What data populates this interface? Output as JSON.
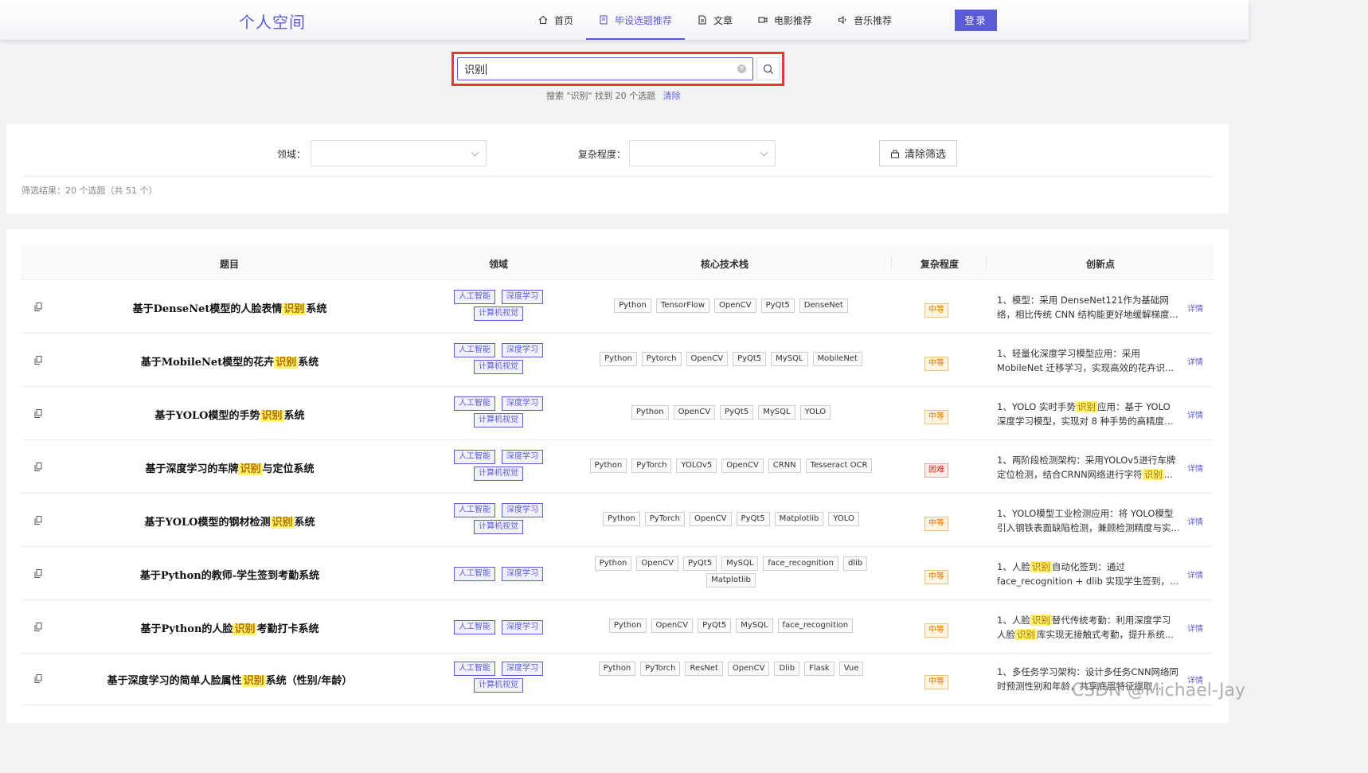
{
  "header": {
    "brand": "个人空间",
    "nav": [
      {
        "label": "首页",
        "icon": "home-icon"
      },
      {
        "label": "毕设选题推荐",
        "icon": "document-icon",
        "active": true
      },
      {
        "label": "文章",
        "icon": "article-icon"
      },
      {
        "label": "电影推荐",
        "icon": "video-icon"
      },
      {
        "label": "音乐推荐",
        "icon": "speaker-icon"
      }
    ],
    "login_label": "登录"
  },
  "search": {
    "value": "识别",
    "hint": "搜索 \"识别\" 找到 20 个选题",
    "clear_label": "清除"
  },
  "filter": {
    "domain_label": "领域：",
    "complexity_label": "复杂程度：",
    "clear_label": "清除筛选",
    "result_text": "筛选结果：20 个选题（共 51 个）"
  },
  "table": {
    "headers": [
      "题目",
      "领域",
      "核心技术栈",
      "复杂程度",
      "创新点"
    ],
    "detail_label": "详情",
    "rows": [
      {
        "title": [
          "基于DenseNet模型的人脸表情",
          "识别",
          "系统"
        ],
        "domains": [
          "人工智能",
          "深度学习",
          "计算机视觉"
        ],
        "tech": [
          "Python",
          "TensorFlow",
          "OpenCV",
          "PyQt5",
          "DenseNet"
        ],
        "complexity": "中等",
        "innovation": [
          "1、模型：采用 DenseNet121作为基础网",
          "络，相比传统 CNN 结构能更好地缓解梯度..."
        ]
      },
      {
        "title": [
          "基于MobileNet模型的花卉",
          "识别",
          "系统"
        ],
        "domains": [
          "人工智能",
          "深度学习",
          "计算机视觉"
        ],
        "tech": [
          "Python",
          "Pytorch",
          "OpenCV",
          "PyQt5",
          "MySQL",
          "MobileNet"
        ],
        "complexity": "中等",
        "innovation": [
          "1、轻量化深度学习模型应用：采用",
          "MobileNet 迁移学习，实现高效的花卉识..."
        ]
      },
      {
        "title": [
          "基于YOLO模型的手势",
          "识别",
          "系统"
        ],
        "domains": [
          "人工智能",
          "深度学习",
          "计算机视觉"
        ],
        "tech": [
          "Python",
          "OpenCV",
          "PyQt5",
          "MySQL",
          "YOLO"
        ],
        "complexity": "中等",
        "innovation": [
          "1、YOLO 实时手势识别应用：基于 YOLO",
          "深度学习模型，实现对 8 种手势的高精度实..."
        ]
      },
      {
        "title": [
          "基于深度学习的车牌",
          "识别",
          "与定位系统"
        ],
        "domains": [
          "人工智能",
          "深度学习",
          "计算机视觉"
        ],
        "tech": [
          "Python",
          "PyTorch",
          "YOLOv5",
          "OpenCV",
          "CRNN",
          "Tesseract OCR"
        ],
        "complexity": "困难",
        "innovation": [
          "1、两阶段检测架构：采用YOLOv5进行车牌",
          "定位检测，结合CRNN网络进行字符识别..."
        ]
      },
      {
        "title": [
          "基于YOLO模型的钢材检测",
          "识别",
          "系统"
        ],
        "domains": [
          "人工智能",
          "深度学习",
          "计算机视觉"
        ],
        "tech": [
          "Python",
          "PyTorch",
          "OpenCV",
          "PyQt5",
          "Matplotlib",
          "YOLO"
        ],
        "complexity": "中等",
        "innovation": [
          "1、YOLO模型工业检测应用：将 YOLO模型",
          "引入钢铁表面缺陷检测，兼顾检测精度与实..."
        ]
      },
      {
        "title": [
          "基于Python的教师-学生签到考勤系统",
          "",
          ""
        ],
        "domains": [
          "人工智能",
          "深度学习"
        ],
        "tech": [
          "Python",
          "OpenCV",
          "PyQt5",
          "MySQL",
          "face_recognition",
          "dlib",
          "Matplotlib"
        ],
        "complexity": "中等",
        "innovation": [
          "1、人脸识别自动化签到：通过",
          "face_recognition + dlib 实现学生签到，替..."
        ]
      },
      {
        "title": [
          "基于Python的人脸",
          "识别",
          "考勤打卡系统"
        ],
        "domains": [
          "人工智能",
          "深度学习"
        ],
        "tech": [
          "Python",
          "OpenCV",
          "PyQt5",
          "MySQL",
          "face_recognition"
        ],
        "complexity": "中等",
        "innovation": [
          "1、人脸识别替代传统考勤：利用深度学习",
          "人脸识别库实现无接触式考勤，提升系统..."
        ]
      },
      {
        "title": [
          "基于深度学习的简单人脸属性",
          "识别",
          "系统（性别/年龄）"
        ],
        "domains": [
          "人工智能",
          "深度学习",
          "计算机视觉"
        ],
        "tech": [
          "Python",
          "PyTorch",
          "ResNet",
          "OpenCV",
          "Dlib",
          "Flask",
          "Vue"
        ],
        "complexity": "中等",
        "innovation": [
          "1、多任务学习架构：设计多任务CNN网络同",
          "时预测性别和年龄，共享底层特征提取..."
        ]
      }
    ]
  },
  "watermark": "CSDN @Michael-Jay"
}
